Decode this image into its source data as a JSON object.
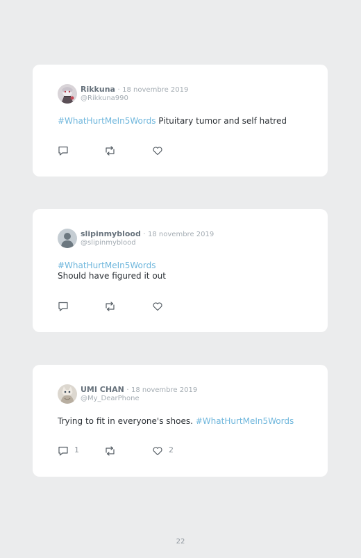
{
  "tweets": [
    {
      "author": "Rikkuna",
      "separator": "·",
      "date": "18 novembre 2019",
      "handle": "@Rikkuna990",
      "hashtag": "#WhatHurtMeIn5Words",
      "text": "Pituitary tumor and self hatred",
      "reply_count": "",
      "like_count": ""
    },
    {
      "author": "slipinmyblood",
      "separator": "·",
      "date": "18 novembre 2019",
      "handle": "@slipinmyblood",
      "hashtag": "#WhatHurtMeIn5Words",
      "text": "Should have figured it out",
      "reply_count": "",
      "like_count": ""
    },
    {
      "author": "UMI CHAN",
      "separator": "·",
      "date": "18 novembre 2019",
      "handle": "@My_DearPhone",
      "text": "Trying to fit in everyone's shoes.",
      "hashtag": "#WhatHurtMeIn5Words",
      "reply_count": "1",
      "like_count": "2"
    }
  ],
  "icons": {
    "reply": "reply-icon",
    "retweet": "retweet-icon",
    "like": "heart-icon",
    "default_avatar": "default-user-avatar"
  },
  "colors": {
    "background": "#ebeced",
    "card": "#ffffff",
    "hashtag": "#6eb6dc",
    "username": "#67727c",
    "muted": "#a4acb3"
  },
  "page_number": "22"
}
